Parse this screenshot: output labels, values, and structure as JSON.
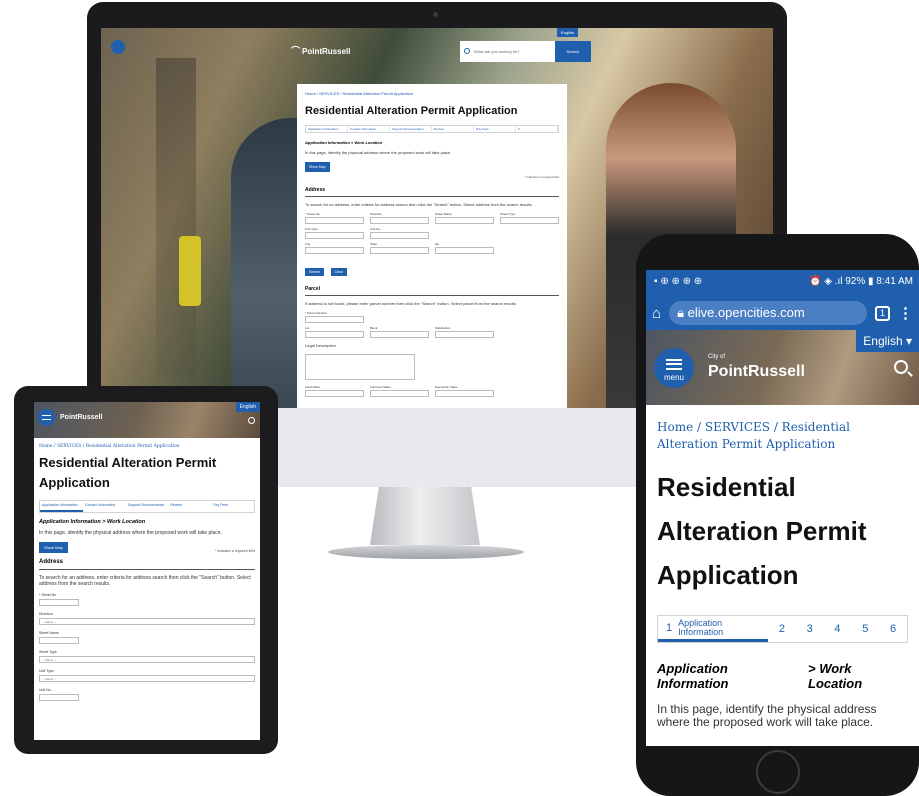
{
  "desktop": {
    "logo": "PointRussell",
    "language": "English",
    "search_placeholder": "What are you looking for?",
    "search_button": "Search",
    "breadcrumb": "Home / SERVICES / Residential Alteration Permit Application",
    "title": "Residential Alteration Permit Application",
    "steps": [
      "Application Information",
      "Contact Information",
      "Support Documentation",
      "Review",
      "Pay Fees",
      "6"
    ],
    "section_subtitle": "Application Information > Work Location",
    "intro": "In this page, identify the physical address where the proposed work will take place.",
    "show_map": "Show Map",
    "required_note": "* Indicates a required field",
    "address_heading": "Address",
    "address_help": "To search for an address, enter criteria for address search then click the \"Search\" button. Select address from the search results.",
    "address_fields": [
      "* Street No.",
      "Direction",
      "Street Name",
      "Street Type",
      "Unit Type",
      "Unit No.",
      "",
      "",
      "City",
      "State",
      "Zip",
      ""
    ],
    "search_btn": "Search",
    "clear_btn": "Clear",
    "parcel_heading": "Parcel",
    "parcel_help": "If address is not found, please enter parcel number then click the \"Search\" button. Select parcel from the search results.",
    "parcel_fields": [
      "* Parcel Number",
      "Lot",
      "Block",
      "Subdivision"
    ],
    "legal_description": "Legal Description",
    "bottom_fields": [
      "Land Value",
      "Improved Value",
      "Exemption Value"
    ]
  },
  "tablet": {
    "logo": "PointRussell",
    "language": "English",
    "breadcrumb": "Home / SERVICES / Residential Alteration Permit Application",
    "title": "Residential Alteration Permit Application",
    "steps": [
      "Application Information",
      "Contact Information",
      "Support Documentation",
      "Review",
      "Pay Fees"
    ],
    "section_subtitle": "Application Information > Work Location",
    "intro": "In this page, identify the physical address where the proposed work will take place.",
    "show_map": "Show Map",
    "required_note": "* Indicates a required field",
    "address_heading": "Address",
    "address_help": "To search for an address, enter criteria for address search then click the \"Search\" button. Select address from the search results.",
    "street_no": "* Street No.",
    "direction": "Direction",
    "select": "-- Select --",
    "street_name": "Street Name",
    "street_type": "Street Type",
    "unit_type": "Unit Type",
    "unit_no": "Unit No."
  },
  "phone": {
    "status_left": "▪ ⊕ ⊕ ⊕ ⊕",
    "status_right": "⏰ ◈ .ıl 92% ▮ 8:41 AM",
    "url": "elive.opencities.com",
    "tab_count": "1",
    "language": "English",
    "menu_label": "menu",
    "logo_small": "City of",
    "logo": "PointRussell",
    "breadcrumb": "Home / SERVICES / Residential Alteration Permit Application",
    "title": "Residential Alteration Permit Application",
    "step1_num": "1",
    "step1_label": "Application Information",
    "steps": [
      "2",
      "3",
      "4",
      "5",
      "6"
    ],
    "section_left": "Application Information",
    "section_right": "> Work Location",
    "intro": "In this page, identify the physical address where the proposed work will take place."
  },
  "colors": {
    "brand_blue": "#1f5fae",
    "device_dark": "#1b1b1d"
  }
}
